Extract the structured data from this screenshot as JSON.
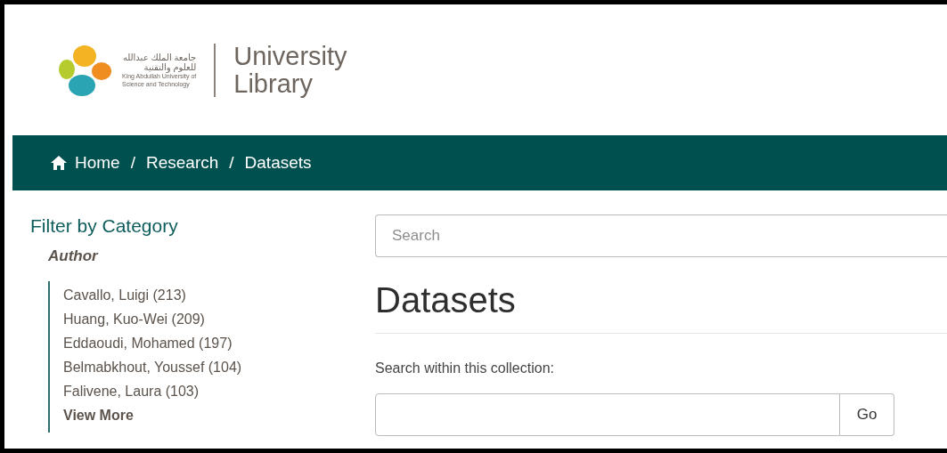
{
  "logo": {
    "arabic_lines": [
      "جامعة الملك عبدالله",
      "للعلوم والتقنية"
    ],
    "english_lines": [
      "King Abdullah University of",
      "Science and Technology"
    ],
    "title_lines": [
      "University",
      "Library"
    ]
  },
  "breadcrumb": [
    {
      "label": "Home",
      "kind": "home"
    },
    {
      "label": "Research",
      "kind": "link"
    },
    {
      "label": "Datasets",
      "kind": "link"
    }
  ],
  "breadcrumb_separator": "/",
  "sidebar": {
    "title": "Filter by Category",
    "facet": "Author",
    "items": [
      {
        "label": "Cavallo, Luigi (213)"
      },
      {
        "label": "Huang, Kuo-Wei (209)"
      },
      {
        "label": "Eddaoudi, Mohamed (197)"
      },
      {
        "label": "Belmabkhout, Youssef (104)"
      },
      {
        "label": "Falivene, Laura (103)"
      },
      {
        "label": "View More"
      }
    ]
  },
  "search": {
    "placeholder": "Search"
  },
  "heading": "Datasets",
  "collection_search": {
    "label": "Search within this collection:",
    "button": "Go"
  }
}
